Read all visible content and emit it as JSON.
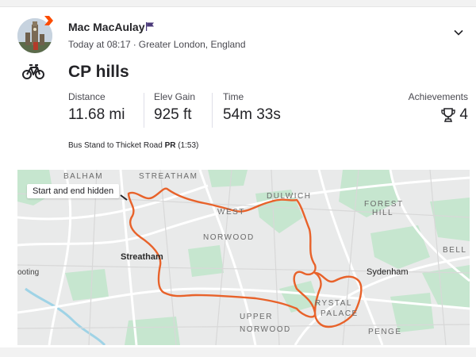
{
  "athlete": {
    "name": "Mac MacAulay",
    "time": "Today at 08:17",
    "location": "Greater London, England"
  },
  "activity": {
    "title": "CP hills",
    "sport_icon": "bike-icon"
  },
  "stats": [
    {
      "label": "Distance",
      "value": "11.68 mi"
    },
    {
      "label": "Elev Gain",
      "value": "925 ft"
    },
    {
      "label": "Time",
      "value": "54m 33s"
    }
  ],
  "achievements": {
    "label": "Achievements",
    "value": "4",
    "icon": "trophy-icon"
  },
  "segment": {
    "name": "Bus Stand to Thicket Road",
    "badge": "PR",
    "time": "(1:53)"
  },
  "map": {
    "privacy_label": "Start and end hidden",
    "route_color": "#e8622a",
    "labels": {
      "balham": "BALHAM",
      "streatham_upper": "STREATHAM",
      "dulwich": "DULWICH",
      "forest_hill": "FOREST\nHILL",
      "west_norwood_1": "WEST",
      "west_norwood_2": "NORWOOD",
      "streatham": "Streatham",
      "tooting": "ooting",
      "sydenham": "Sydenham",
      "bell": "BELL",
      "crystal_palace_1": "RYSTAL",
      "crystal_palace_2": "PALACE",
      "upper_norwood_1": "UPPER",
      "upper_norwood_2": "NORWOOD",
      "penge": "PENGE"
    }
  },
  "colors": {
    "accent": "#fc4c02",
    "text": "#242428",
    "muted": "#494950",
    "map_green": "#c6e6cf",
    "map_water": "#9fd3e6"
  }
}
